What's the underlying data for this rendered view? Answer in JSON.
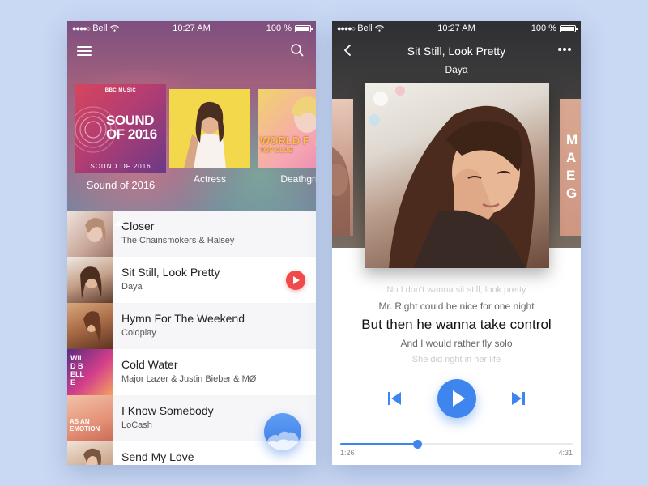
{
  "status_bar": {
    "carrier": "Bell",
    "time": "10:27 AM",
    "battery": "100 %"
  },
  "library": {
    "albums": [
      {
        "caption": "Sound of 2016",
        "art_brand": "BBC MUSIC",
        "art_title_1": "SOUND",
        "art_title_2": "OF 2016",
        "art_subtitle": "SOUND OF 2016"
      },
      {
        "caption": "Actress"
      },
      {
        "caption": "Deathgri",
        "art_text": "WORLD F",
        "art_text_2": "TOP CLUB"
      }
    ],
    "songs": [
      {
        "title": "Closer",
        "artist": "The Chainsmokers & Halsey"
      },
      {
        "title": "Sit Still, Look Pretty",
        "artist": "Daya",
        "playing": true
      },
      {
        "title": "Hymn For The Weekend",
        "artist": "Coldplay"
      },
      {
        "title": "Cold Water",
        "artist": "Major Lazer & Justin Bieber & MØ",
        "thumb_text": "WILD BELLE"
      },
      {
        "title": "I Know Somebody",
        "artist": "LoCash",
        "thumb_text": "AS AN EMOTION"
      },
      {
        "title": "Send My Love",
        "artist": ""
      }
    ]
  },
  "now_playing": {
    "title": "Sit Still, Look Pretty",
    "artist": "Daya",
    "side_cover_text": "M A E G",
    "lyrics": {
      "prev_2": "No I don't wanna sit still, look pretty",
      "prev_1": "Mr. Right could be nice for one night",
      "current": "But then he wanna take control",
      "next_1": "And I would rather fly solo",
      "next_2": "She did right in her life"
    },
    "elapsed": "1:26",
    "total": "4:31",
    "progress": 0.33
  },
  "colors": {
    "accent": "#3f85ee",
    "playing_badge": "#ef4b4b",
    "background": "#c9d8f3"
  },
  "icons": [
    "menu-icon",
    "search-icon",
    "back-icon",
    "more-icon",
    "previous-icon",
    "play-icon",
    "next-icon",
    "wifi-icon",
    "battery-icon"
  ]
}
